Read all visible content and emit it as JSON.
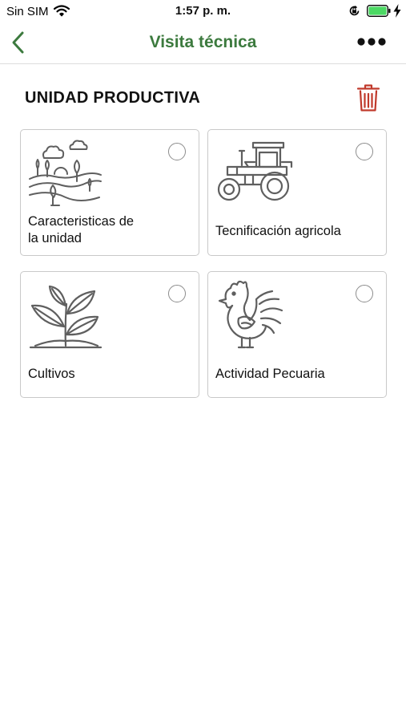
{
  "status_bar": {
    "carrier": "Sin SIM",
    "time": "1:57 p. m."
  },
  "nav": {
    "title": "Visita técnica"
  },
  "section": {
    "title": "UNIDAD PRODUCTIVA"
  },
  "cards": [
    {
      "label_line1": "Caracteristicas de",
      "label_line2": "la unidad",
      "icon": "landscape-icon",
      "selected": false
    },
    {
      "label": "Tecnificación agricola",
      "icon": "tractor-icon",
      "selected": false
    },
    {
      "label": "Cultivos",
      "icon": "plant-icon",
      "selected": false
    },
    {
      "label": "Actividad Pecuaria",
      "icon": "rooster-icon",
      "selected": false
    }
  ],
  "colors": {
    "accent_green": "#3c7a3e",
    "delete_red": "#c0392b",
    "battery_green": "#4cd964",
    "icon_gray": "#5f5f5f"
  }
}
